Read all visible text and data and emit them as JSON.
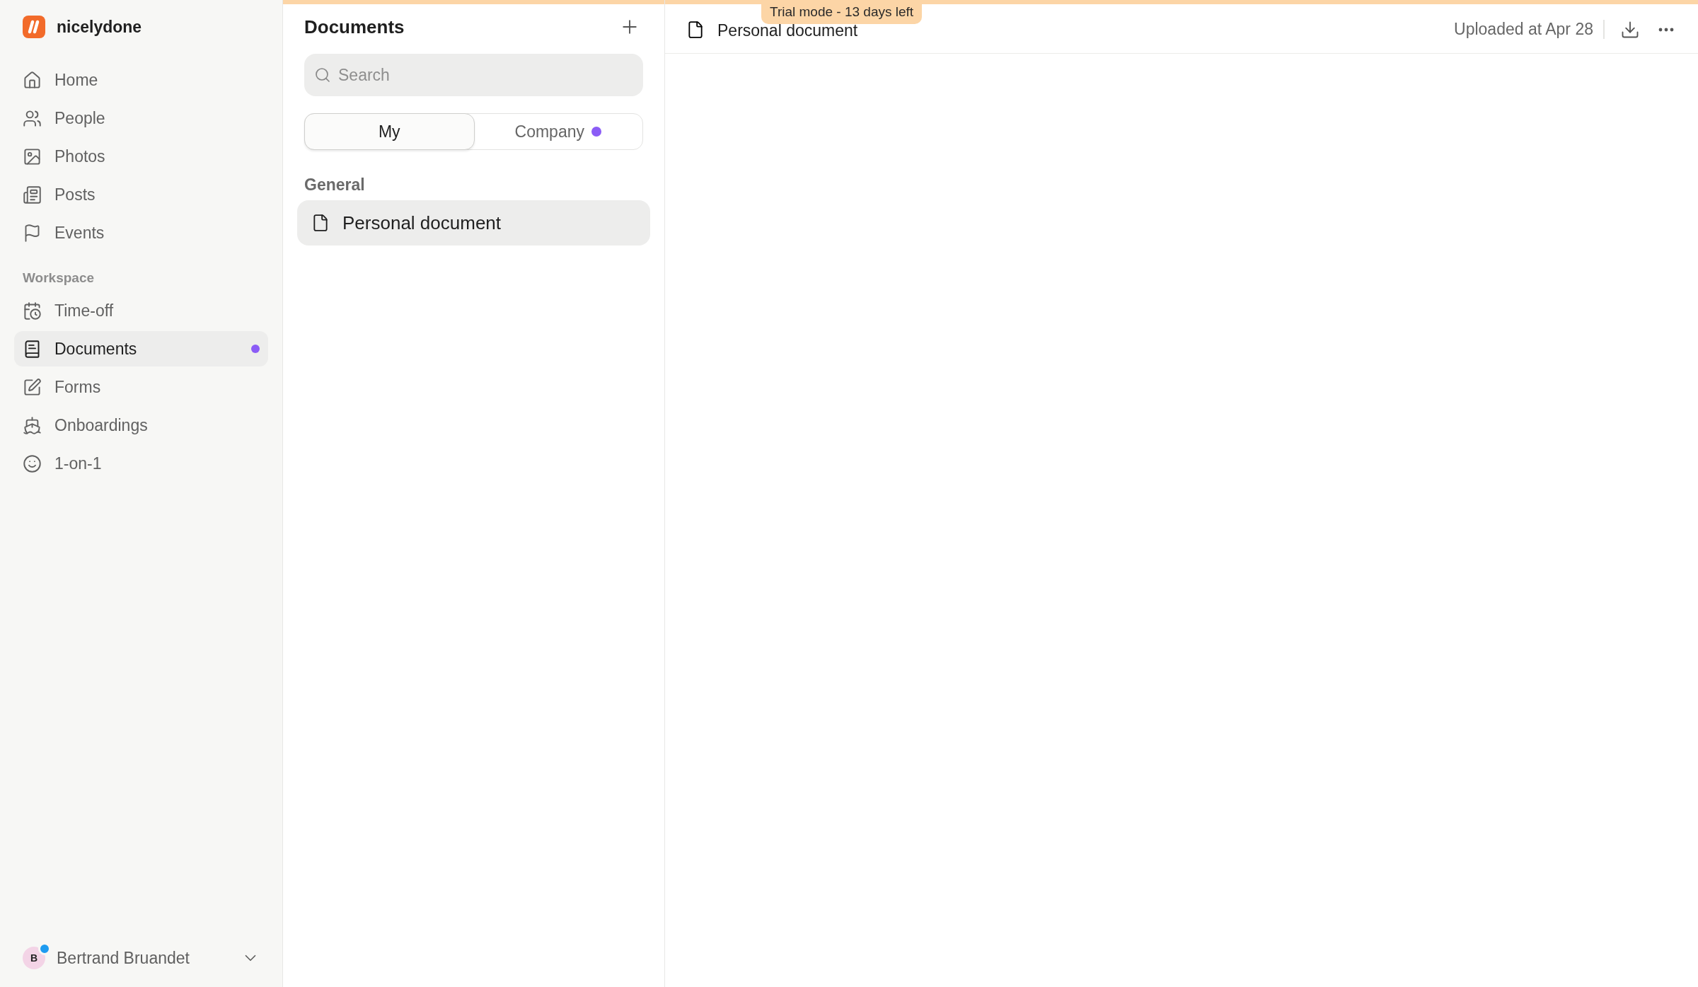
{
  "sidebar": {
    "brand": "nicelydone",
    "items": [
      {
        "label": "Home",
        "selected": false,
        "dot": false
      },
      {
        "label": "People",
        "selected": false,
        "dot": false
      },
      {
        "label": "Photos",
        "selected": false,
        "dot": false
      },
      {
        "label": "Posts",
        "selected": false,
        "dot": false
      },
      {
        "label": "Events",
        "selected": false,
        "dot": false
      }
    ],
    "section_title": "Workspace",
    "workspace_items": [
      {
        "label": "Time-off",
        "selected": false,
        "dot": false
      },
      {
        "label": "Documents",
        "selected": true,
        "dot": true
      },
      {
        "label": "Forms",
        "selected": false,
        "dot": false
      },
      {
        "label": "Onboardings",
        "selected": false,
        "dot": false
      },
      {
        "label": "1-on-1",
        "selected": false,
        "dot": false
      }
    ],
    "user": {
      "initial": "B",
      "name": "Bertrand Bruandet",
      "online": true
    }
  },
  "documents_panel": {
    "title": "Documents",
    "search": {
      "placeholder": "Search"
    },
    "tabs": [
      {
        "label": "My",
        "selected": true,
        "dot": false
      },
      {
        "label": "Company",
        "selected": false,
        "dot": true
      }
    ],
    "groups": [
      {
        "title": "General",
        "items": [
          {
            "label": "Personal document",
            "selected": true
          }
        ]
      }
    ]
  },
  "viewer": {
    "title": "Personal document",
    "uploaded": "Uploaded at Apr 28"
  },
  "trial_banner": "Trial mode - 13 days left"
}
